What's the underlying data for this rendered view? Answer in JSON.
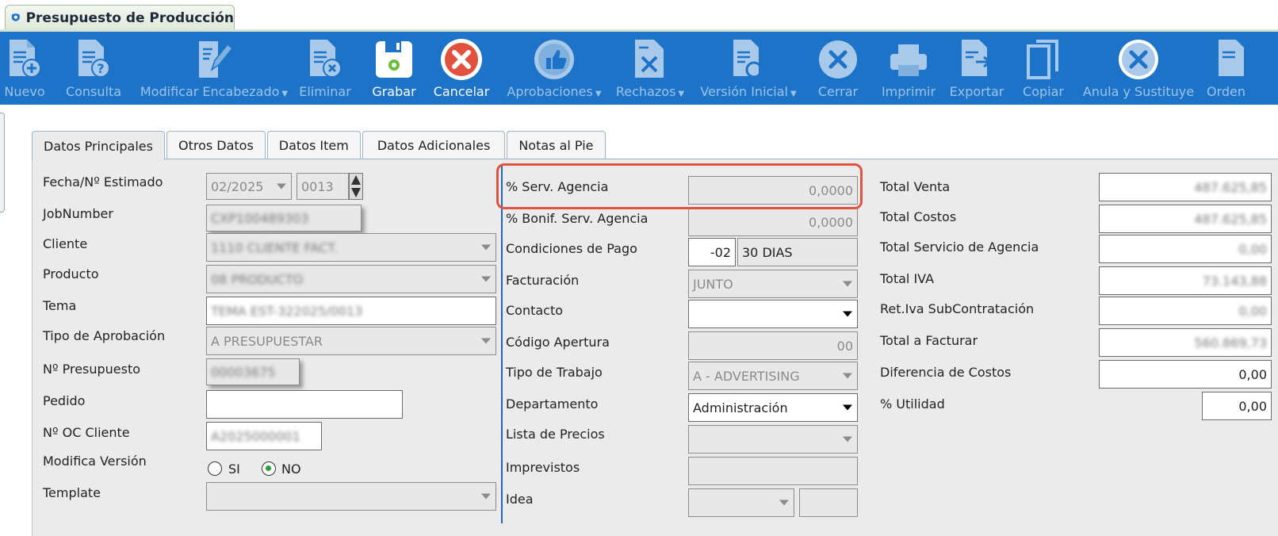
{
  "window": {
    "title": "Presupuesto de Producción"
  },
  "toolbar": {
    "nuevo": "Nuevo",
    "consulta": "Consulta",
    "modificar": "Modificar Encabezado",
    "eliminar": "Eliminar",
    "grabar": "Grabar",
    "cancelar": "Cancelar",
    "aprobaciones": "Aprobaciones",
    "rechazos": "Rechazos",
    "version": "Versión Inicial",
    "cerrar": "Cerrar",
    "imprimir": "Imprimir",
    "exportar": "Exportar",
    "copiar": "Copiar",
    "anula": "Anula y Sustituye",
    "orden": "Orden"
  },
  "tabs": [
    "Datos Principales",
    "Otros Datos",
    "Datos Item",
    "Datos Adicionales",
    "Notas al Pie"
  ],
  "left": {
    "fecha_label": "Fecha/Nº Estimado",
    "fecha_value": "02/2025",
    "estimado_value": "0013",
    "jobnumber_label": "JobNumber",
    "jobnumber_value": "CXP100489303",
    "cliente_label": "Cliente",
    "cliente_value": "1110 CLIENTE FACT.",
    "producto_label": "Producto",
    "producto_value": "08 PRODUCTO",
    "tema_label": "Tema",
    "tema_value": "TEMA EST-322025/0013",
    "tipo_aprob_label": "Tipo de Aprobación",
    "tipo_aprob_value": "A PRESUPUESTAR",
    "presupuesto_label": "Nº Presupuesto",
    "presupuesto_value": "00003675",
    "pedido_label": "Pedido",
    "pedido_value": "",
    "oc_label": "Nº OC Cliente",
    "oc_value": "A2025000001",
    "modifica_label": "Modifica Versión",
    "si": "SI",
    "no": "NO",
    "template_label": "Template",
    "template_value": ""
  },
  "middle": {
    "serv_label": "% Serv. Agencia",
    "serv_value": "0,0000",
    "bonif_label": "% Bonif. Serv. Agencia",
    "bonif_value": "0,0000",
    "cond_label": "Condiciones de Pago",
    "cond_code": "-02",
    "cond_value": "30 DIAS",
    "fact_label": "Facturación",
    "fact_value": "JUNTO",
    "contacto_label": "Contacto",
    "contacto_value": "",
    "codigo_label": "Código Apertura",
    "codigo_value": "00",
    "tipo_trabajo_label": "Tipo de Trabajo",
    "tipo_trabajo_value": "A - ADVERTISING",
    "depto_label": "Departamento",
    "depto_value": "Administración",
    "lista_label": "Lista de Precios",
    "lista_value": "",
    "imprev_label": "Imprevistos",
    "imprev_value": "",
    "idea_label": "Idea",
    "idea_value": ""
  },
  "totals": {
    "venta_label": "Total Venta",
    "venta_value": "487.625,85",
    "costos_label": "Total Costos",
    "costos_value": "487.625,85",
    "serv_label": "Total Servicio de Agencia",
    "serv_value": "0,00",
    "iva_label": "Total IVA",
    "iva_value": "73.143,88",
    "retiva_label": "Ret.Iva SubContratación",
    "retiva_value": "0,00",
    "facturar_label": "Total a Facturar",
    "facturar_value": "560.869,73",
    "dif_label": "Diferencia de Costos",
    "dif_value": "0,00",
    "util_label": "% Utilidad",
    "util_value": "0,00"
  }
}
